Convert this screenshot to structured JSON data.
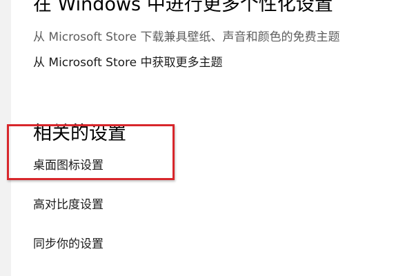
{
  "personalize": {
    "title": "在 Windows 中进行更多个性化设置",
    "description": "从 Microsoft Store 下载兼具壁纸、声音和颜色的免费主题",
    "get_more_themes_link": "从 Microsoft Store 中获取更多主题"
  },
  "related_settings": {
    "title": "相关的设置",
    "links": [
      "桌面图标设置",
      "高对比度设置",
      "同步你的设置"
    ]
  },
  "annotation": {
    "highlight_color": "#d8262b"
  }
}
